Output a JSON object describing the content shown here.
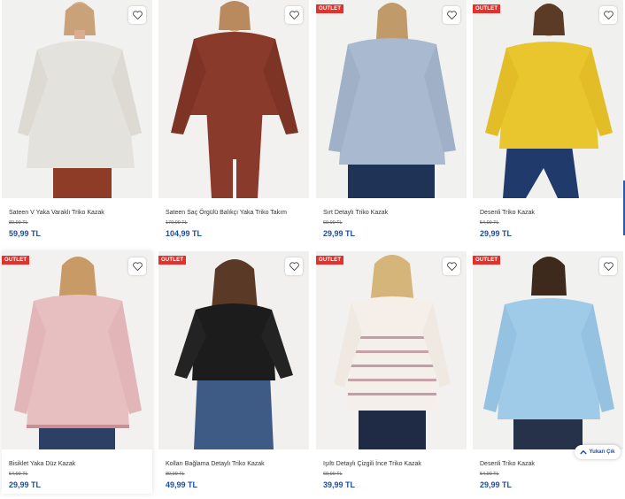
{
  "products": [
    {
      "name": "Sateen V Yaka Varaklı Triko Kazak",
      "old_price": "89,99 TL",
      "price": "59,99 TL",
      "outlet": ""
    },
    {
      "name": "Sateen Saç Örgülü Balıkçı Yaka Triko Takım",
      "old_price": "179,99 TL",
      "price": "104,99 TL",
      "outlet": ""
    },
    {
      "name": "Sırt Detaylı Triko Kazak",
      "old_price": "69,99 TL",
      "price": "29,99 TL",
      "outlet": "OUTLET"
    },
    {
      "name": "Desenli Triko Kazak",
      "old_price": "54,99 TL",
      "price": "29,99 TL",
      "outlet": "OUTLET"
    },
    {
      "name": "Bisiklet Yaka Düz Kazak",
      "old_price": "54,99 TL",
      "price": "29,99 TL",
      "outlet": "OUTLET"
    },
    {
      "name": "Kolları Bağlama Detaylı Triko Kazak",
      "old_price": "89,99 TL",
      "price": "49,99 TL",
      "outlet": "OUTLET"
    },
    {
      "name": "Işıltı Detaylı Çizgili İnce Triko Kazak",
      "old_price": "69,99 TL",
      "price": "39,99 TL",
      "outlet": "OUTLET"
    },
    {
      "name": "Desenli Triko Kazak",
      "old_price": "54,99 TL",
      "price": "29,99 TL",
      "outlet": "OUTLET"
    }
  ],
  "scroll_top": {
    "label": "Yukarı Çık"
  },
  "colors": {
    "price": "#1d4e9c",
    "outlet": "#e4312b"
  },
  "icons": {
    "favorite": "heart-icon",
    "scroll_up": "chevron-up-icon"
  }
}
